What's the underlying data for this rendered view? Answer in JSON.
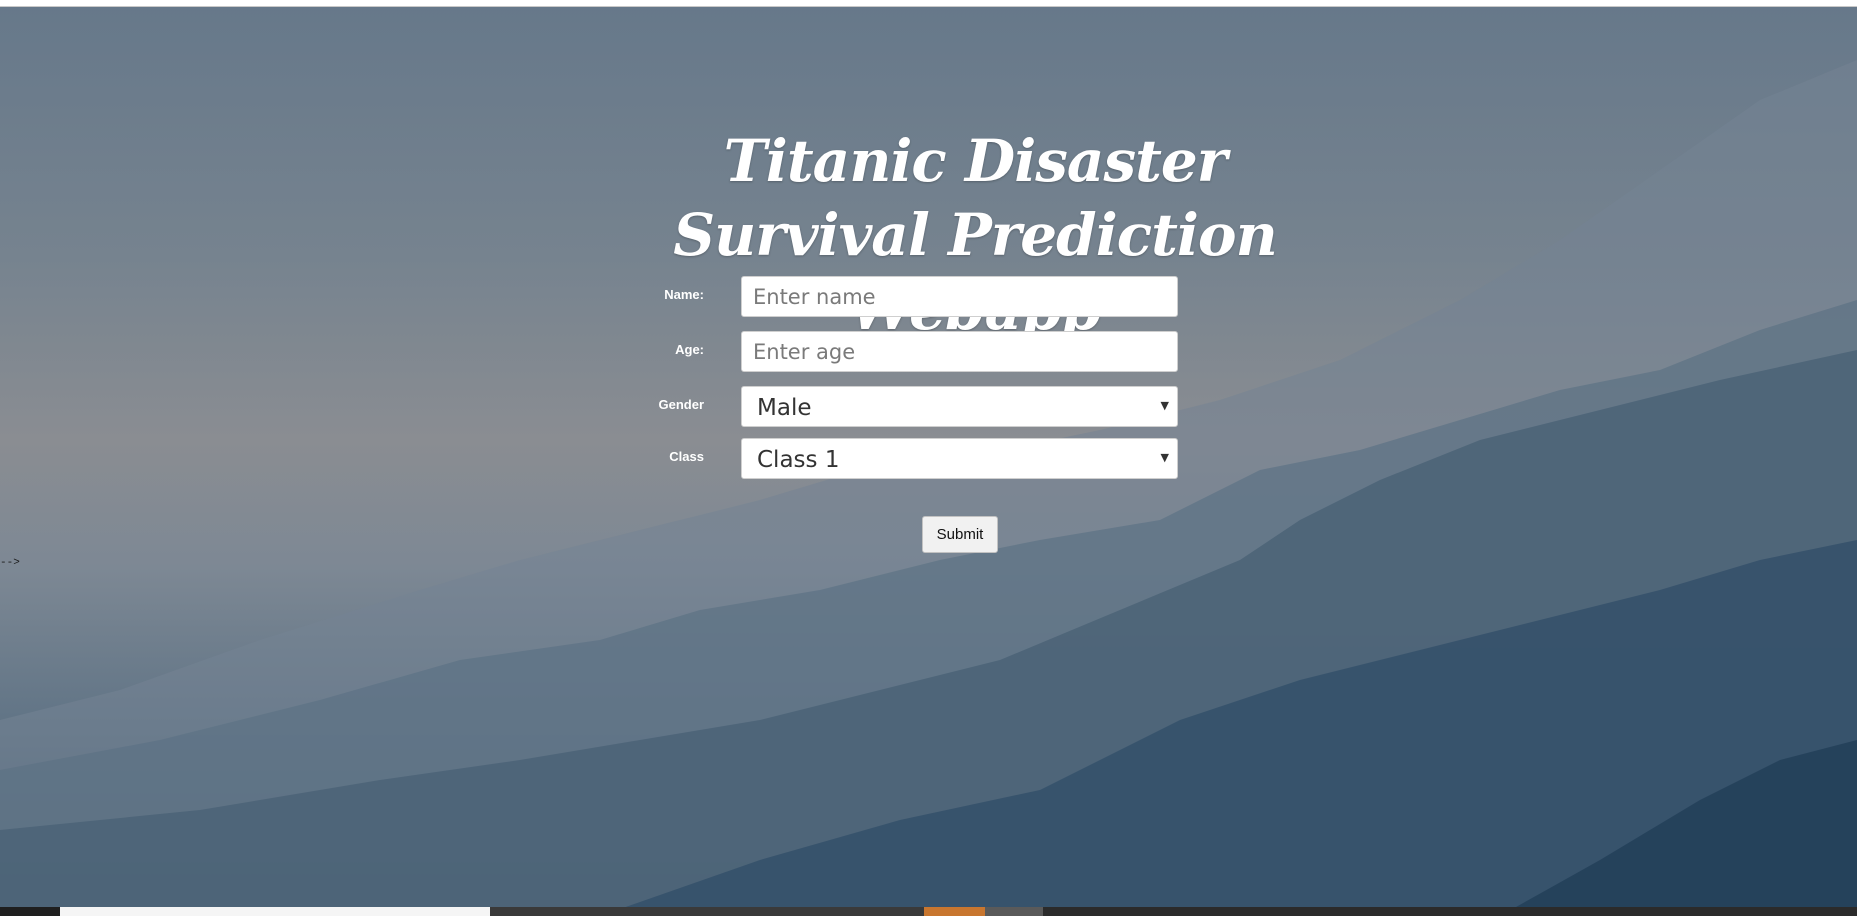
{
  "header": {
    "title": "Titanic Disaster Survival Prediction Webapp"
  },
  "form": {
    "name_label": "Name:",
    "name_placeholder": "Enter name",
    "name_value": "",
    "age_label": "Age:",
    "age_placeholder": "Enter age",
    "age_value": "",
    "gender_label": "Gender",
    "gender_selected": "Male",
    "class_label": "Class",
    "class_selected": "Class 1",
    "submit_label": "Submit"
  },
  "stray_text": "-->",
  "colors": {
    "title_text": "#ffffff",
    "label_text": "#ffffff",
    "field_background": "#ffffff",
    "button_background": "#f1f1f1",
    "accent_taskbar": "#c8762f"
  },
  "icons": {
    "select_arrow": "chevron-down-icon"
  }
}
